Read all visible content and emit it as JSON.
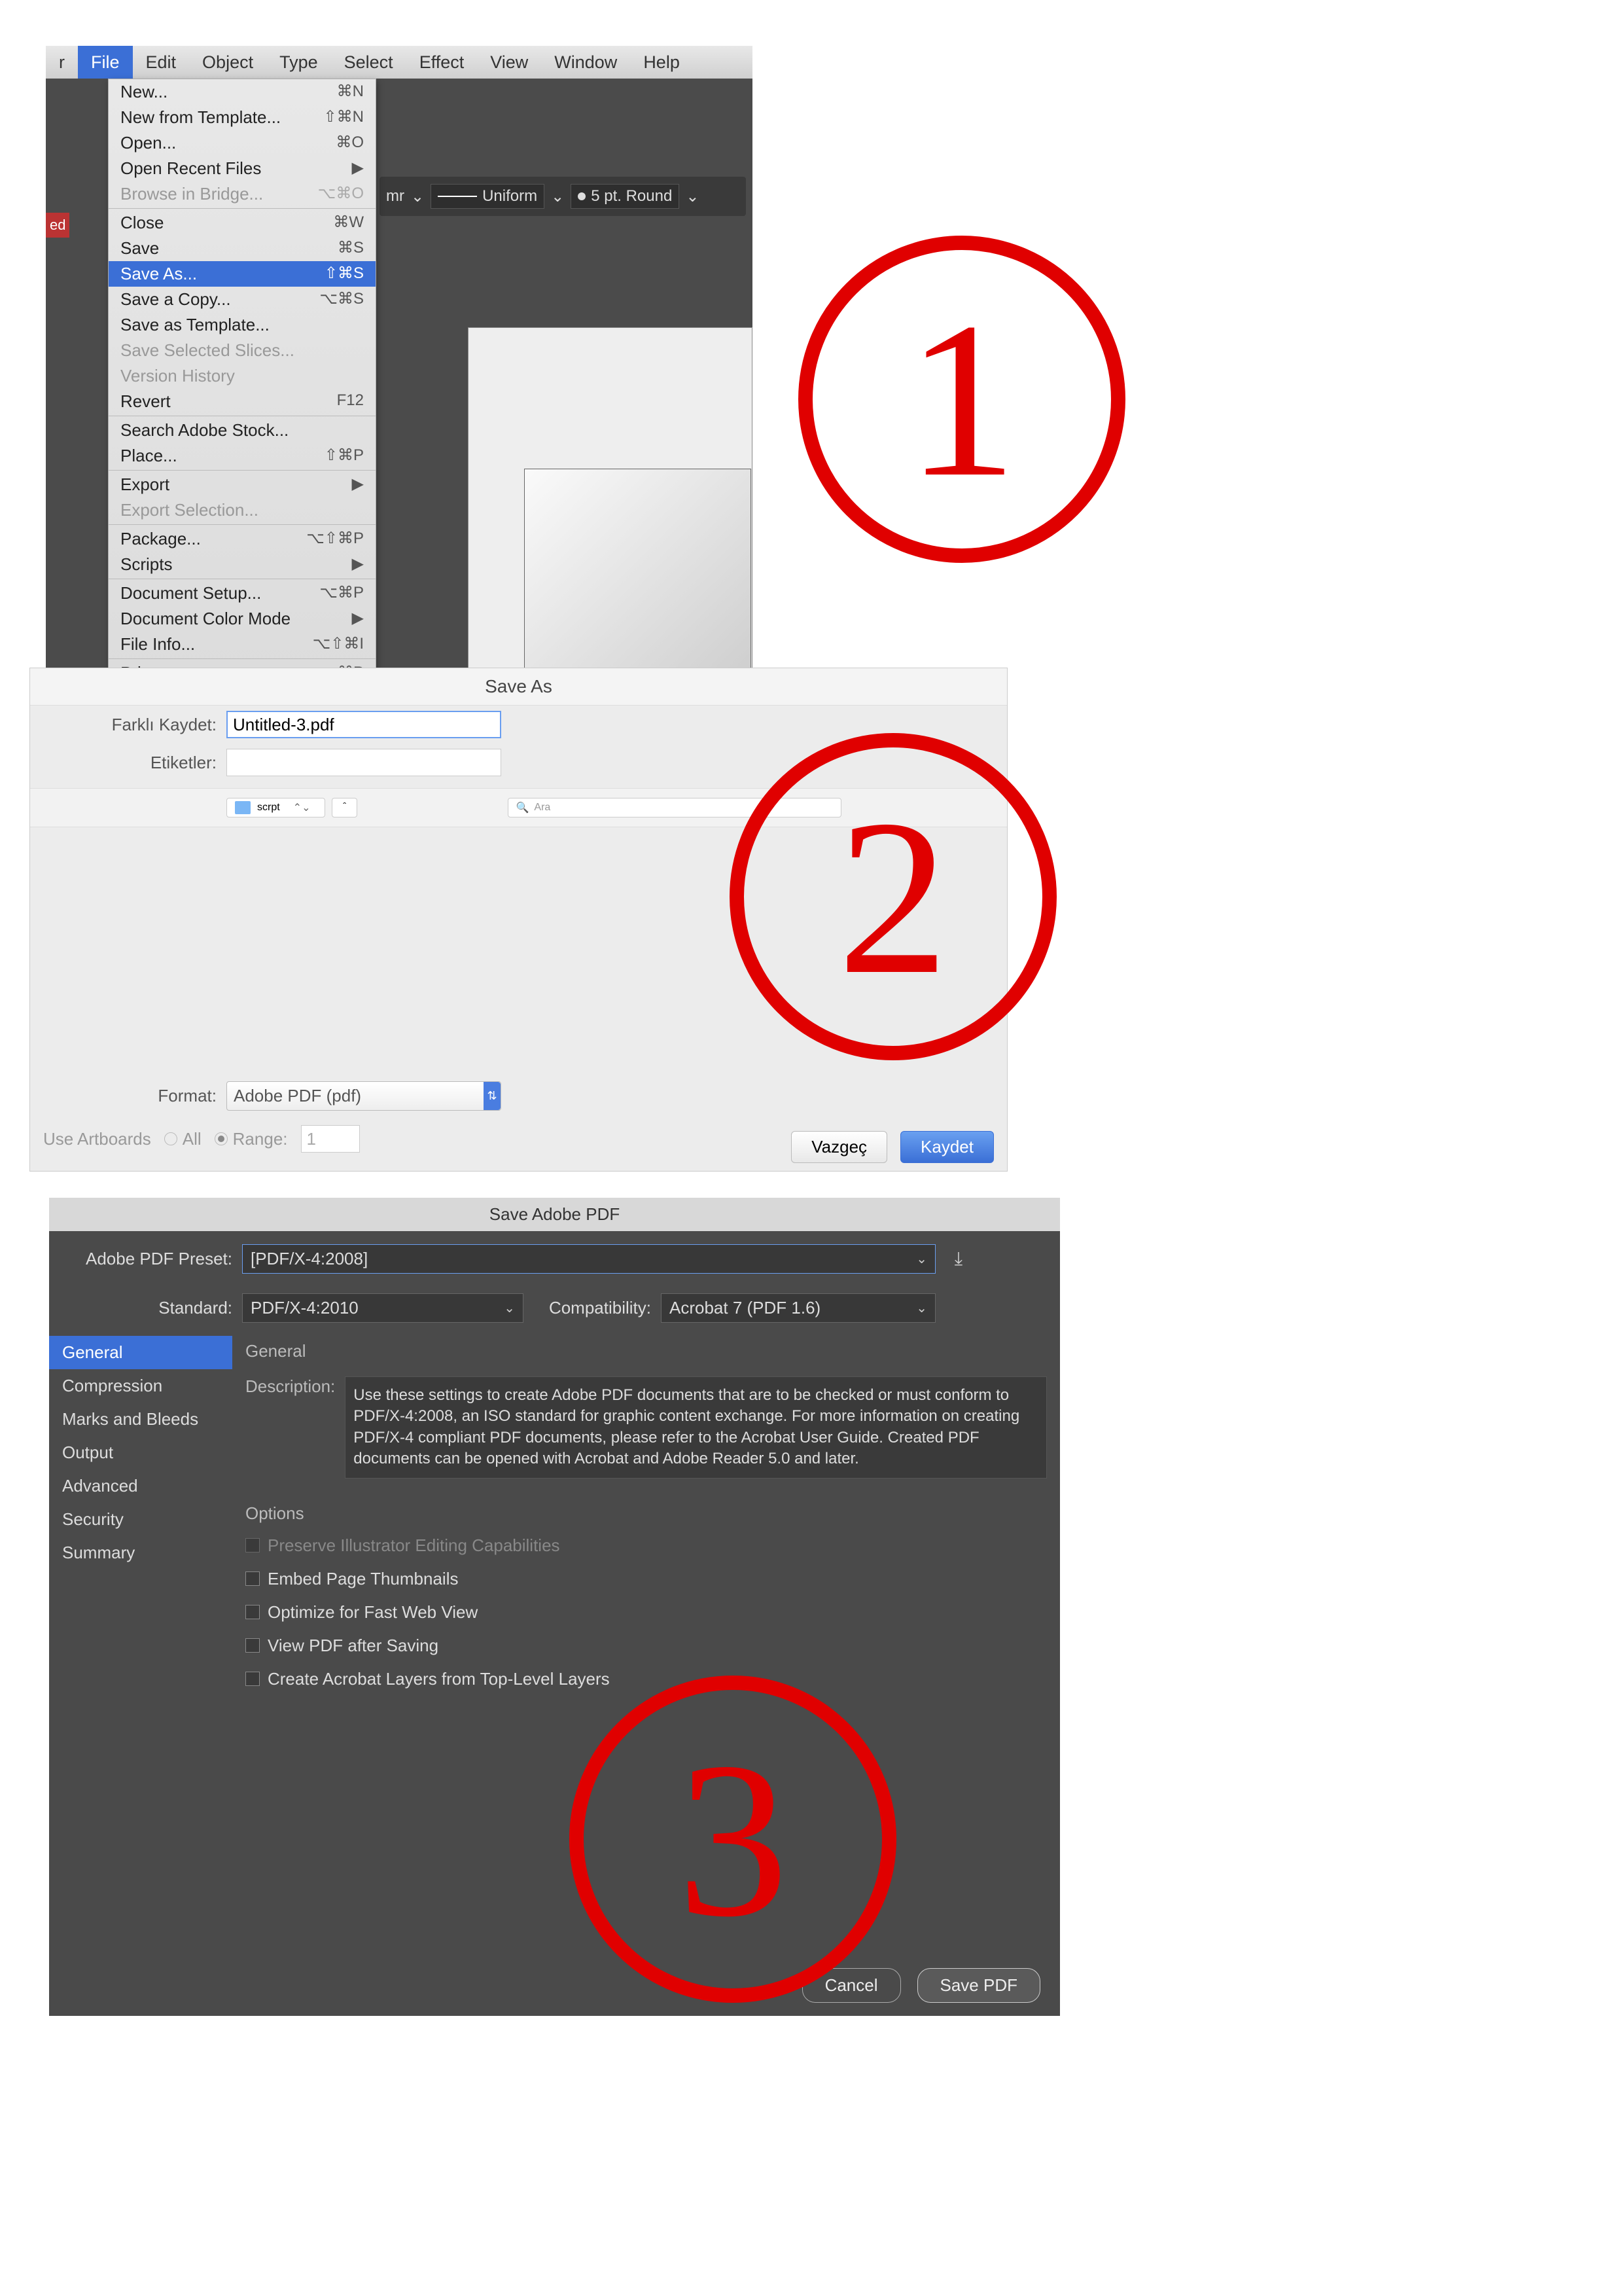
{
  "annotations": {
    "step1": "1",
    "step2": "2",
    "step3": "3"
  },
  "panel1": {
    "menubar": [
      "r",
      "File",
      "Edit",
      "Object",
      "Type",
      "Select",
      "Effect",
      "View",
      "Window",
      "Help"
    ],
    "menubar_active_index": 1,
    "ed_label": "ed",
    "toolbar": {
      "mr": "mr",
      "uniform": "Uniform",
      "round": "5 pt. Round"
    },
    "menu": [
      {
        "label": "New...",
        "sc": "⌘N"
      },
      {
        "label": "New from Template...",
        "sc": "⇧⌘N"
      },
      {
        "label": "Open...",
        "sc": "⌘O"
      },
      {
        "label": "Open Recent Files",
        "sc": "▶"
      },
      {
        "label": "Browse in Bridge...",
        "sc": "⌥⌘O",
        "dis": true
      },
      {
        "sep": true
      },
      {
        "label": "Close",
        "sc": "⌘W"
      },
      {
        "label": "Save",
        "sc": "⌘S"
      },
      {
        "label": "Save As...",
        "sc": "⇧⌘S",
        "sel": true
      },
      {
        "label": "Save a Copy...",
        "sc": "⌥⌘S"
      },
      {
        "label": "Save as Template..."
      },
      {
        "label": "Save Selected Slices...",
        "dis": true
      },
      {
        "label": "Version History",
        "dis": true
      },
      {
        "label": "Revert",
        "sc": "F12"
      },
      {
        "sep": true
      },
      {
        "label": "Search Adobe Stock..."
      },
      {
        "label": "Place...",
        "sc": "⇧⌘P"
      },
      {
        "sep": true
      },
      {
        "label": "Export",
        "sc": "▶"
      },
      {
        "label": "Export Selection...",
        "dis": true
      },
      {
        "sep": true
      },
      {
        "label": "Package...",
        "sc": "⌥⇧⌘P"
      },
      {
        "label": "Scripts",
        "sc": "▶"
      },
      {
        "sep": true
      },
      {
        "label": "Document Setup...",
        "sc": "⌥⌘P"
      },
      {
        "label": "Document Color Mode",
        "sc": "▶"
      },
      {
        "label": "File Info...",
        "sc": "⌥⇧⌘I"
      },
      {
        "sep": true
      },
      {
        "label": "Print...",
        "sc": "⌘P"
      }
    ]
  },
  "panel2": {
    "title": "Save As",
    "name_label": "Farklı Kaydet:",
    "name_value": "Untitled-3.pdf",
    "tags_label": "Etiketler:",
    "folder": "scrpt",
    "search_placeholder": "Ara",
    "format_label": "Format:",
    "format_value": "Adobe PDF (pdf)",
    "artboards_label": "Use Artboards",
    "all_label": "All",
    "range_label": "Range:",
    "range_value": "1",
    "cancel": "Vazgeç",
    "save": "Kaydet"
  },
  "panel3": {
    "title": "Save Adobe PDF",
    "preset_label": "Adobe PDF Preset:",
    "preset_value": "[PDF/X-4:2008]",
    "standard_label": "Standard:",
    "standard_value": "PDF/X-4:2010",
    "compat_label": "Compatibility:",
    "compat_value": "Acrobat 7 (PDF 1.6)",
    "sidebar": [
      "General",
      "Compression",
      "Marks and Bleeds",
      "Output",
      "Advanced",
      "Security",
      "Summary"
    ],
    "section": "General",
    "desc_label": "Description:",
    "desc_text": "Use these settings to create Adobe PDF documents that are to be checked or must conform to PDF/X-4:2008, an ISO standard for graphic content exchange.  For more information on creating PDF/X-4 compliant PDF documents, please refer to the Acrobat User Guide.  Created PDF documents can be opened with Acrobat and Adobe Reader 5.0 and later.",
    "options_label": "Options",
    "opts": [
      {
        "label": "Preserve Illustrator Editing Capabilities",
        "dis": true
      },
      {
        "label": "Embed Page Thumbnails"
      },
      {
        "label": "Optimize for Fast Web View"
      },
      {
        "label": "View PDF after Saving"
      },
      {
        "label": "Create Acrobat Layers from Top-Level Layers"
      }
    ],
    "cancel": "Cancel",
    "save": "Save PDF"
  }
}
